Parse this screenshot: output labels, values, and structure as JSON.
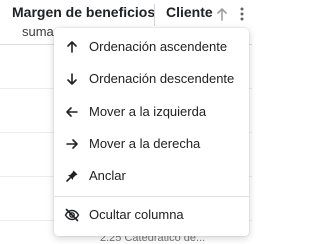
{
  "grid": {
    "columns": [
      {
        "title": "Margen de beneficios",
        "subtitle": "suma"
      },
      {
        "title": "Cliente"
      }
    ],
    "bottom_fragment": "2.25 Catedrático de..."
  },
  "column_menu": {
    "items": [
      {
        "label": "Ordenación ascendente",
        "icon": "arrow-up-icon"
      },
      {
        "label": "Ordenación descendente",
        "icon": "arrow-down-icon"
      },
      {
        "label": "Mover a la izquierda",
        "icon": "arrow-left-icon"
      },
      {
        "label": "Mover a la derecha",
        "icon": "arrow-right-icon"
      },
      {
        "label": "Anclar",
        "icon": "pin-icon"
      },
      {
        "label": "Ocultar columna",
        "icon": "eye-off-icon"
      }
    ]
  },
  "colors": {
    "text": "#202124",
    "border": "#dcdcdc",
    "menu_bg": "#ffffff"
  }
}
